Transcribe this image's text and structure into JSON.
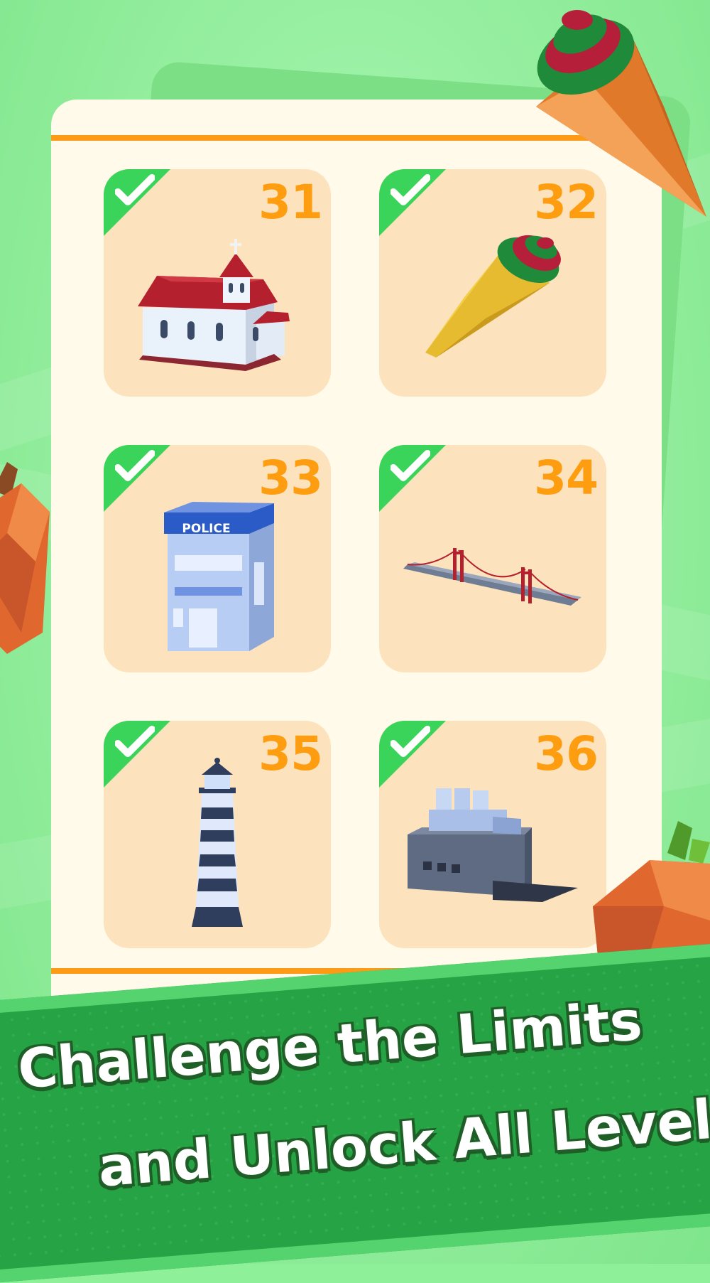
{
  "levels": [
    {
      "number": "31",
      "completed": true,
      "icon": "church-icon"
    },
    {
      "number": "32",
      "completed": true,
      "icon": "ice-cream-cone-icon"
    },
    {
      "number": "33",
      "completed": true,
      "icon": "police-station-icon"
    },
    {
      "number": "34",
      "completed": true,
      "icon": "suspension-bridge-icon"
    },
    {
      "number": "35",
      "completed": true,
      "icon": "lighthouse-icon"
    },
    {
      "number": "36",
      "completed": true,
      "icon": "factory-icon"
    }
  ],
  "police_sign": "POLICE",
  "banner": {
    "line1": "Challenge the Limits",
    "line2": "and Unlock All Levels"
  },
  "colors": {
    "accent": "#ff9d10",
    "check_green": "#3bd45a",
    "banner_green": "#25a345",
    "card": "#fde3bd",
    "panel": "#fffaea"
  }
}
